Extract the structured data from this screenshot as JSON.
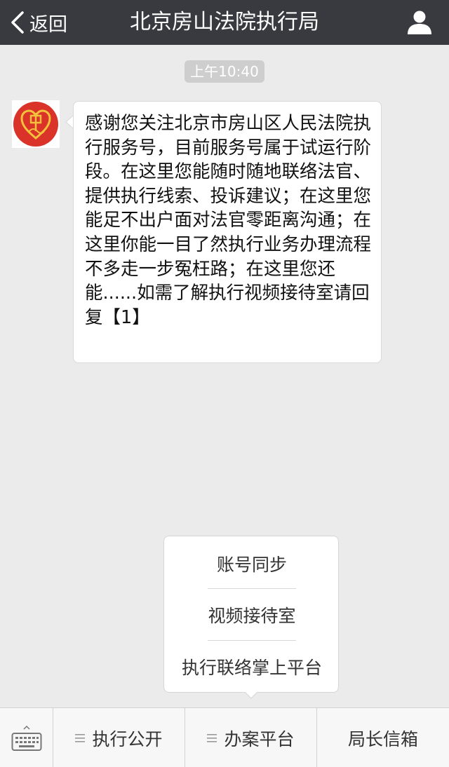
{
  "header": {
    "back_label": "返回",
    "title": "北京房山法院执行局"
  },
  "chat": {
    "timestamp": "上午10:40",
    "message": "感谢您关注北京市房山区人民法院执行服务号，目前服务号属于试运行阶段。在这里您能随时随地联络法官、提供执行线索、投诉建议；在这里您能足不出户面对法官零距离沟通；在这里你能一目了然执行业务办理流程不多走一步冤枉路；在这里您还能......如需了解执行视频接待室请回复【1】"
  },
  "popup": {
    "items": [
      "账号同步",
      "视频接待室",
      "执行联络掌上平台"
    ]
  },
  "menu": {
    "tabs": [
      "执行公开",
      "办案平台",
      "局长信箱"
    ]
  },
  "colors": {
    "header_bg": "#393a3f",
    "chat_bg": "#ebebeb",
    "avatar_red": "#d9332a",
    "avatar_gold": "#f2c23a"
  },
  "icons": {
    "back": "chevron-left-icon",
    "profile": "person-icon",
    "keyboard": "keyboard-icon",
    "menu": "menu-lines-icon"
  }
}
